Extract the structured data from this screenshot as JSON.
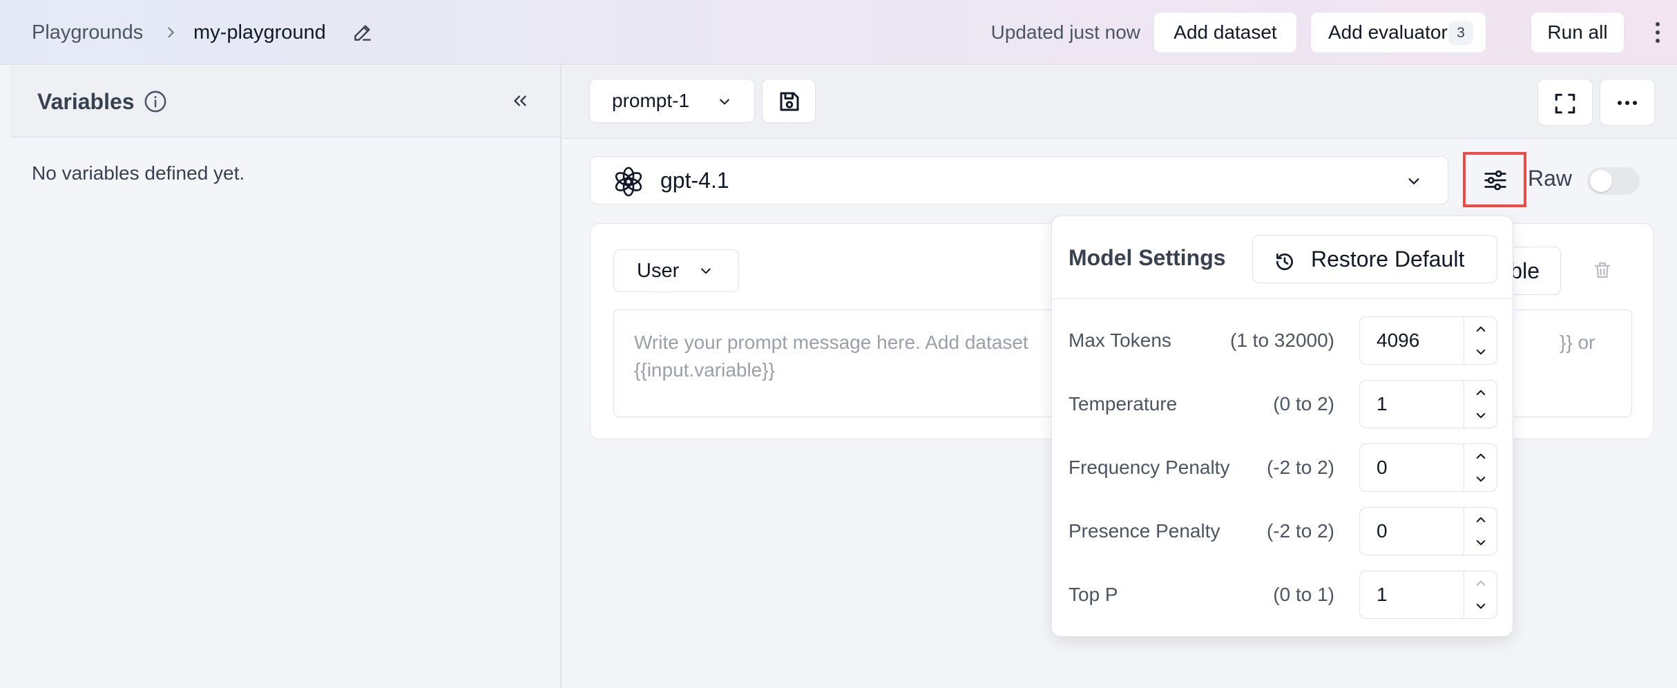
{
  "header": {
    "breadcrumb_root": "Playgrounds",
    "breadcrumb_current": "my-playground",
    "updated_text": "Updated just now",
    "add_dataset_label": "Add dataset",
    "add_evaluator_label": "Add evaluator",
    "evaluator_count": "3",
    "run_all_label": "Run all"
  },
  "variables_panel": {
    "title": "Variables",
    "empty_text": "No variables defined yet."
  },
  "prompt_toolbar": {
    "prompt_name": "prompt-1"
  },
  "model": {
    "name": "gpt-4.1",
    "raw_label": "Raw",
    "raw_enabled": false
  },
  "message": {
    "role": "User",
    "partial_button_text": "ble",
    "placeholder_line1": "Write your prompt message here. Add dataset",
    "placeholder_right_fragment": "}} or",
    "placeholder_line2": "{{input.variable}}"
  },
  "model_settings": {
    "title": "Model Settings",
    "restore_label": "Restore Default",
    "rows": [
      {
        "name": "Max Tokens",
        "range": "(1 to 32000)",
        "value": "4096"
      },
      {
        "name": "Temperature",
        "range": "(0 to 2)",
        "value": "1"
      },
      {
        "name": "Frequency Penalty",
        "range": "(-2 to 2)",
        "value": "0"
      },
      {
        "name": "Presence Penalty",
        "range": "(-2 to 2)",
        "value": "0"
      },
      {
        "name": "Top P",
        "range": "(0 to 1)",
        "value": "1"
      }
    ]
  },
  "colors": {
    "highlight": "#ef4b45",
    "header_gradient_start": "#e5e9f6",
    "header_gradient_end": "#f2e4f0"
  },
  "icons": [
    "chevron-right-icon",
    "pencil-icon",
    "kebab-icon",
    "info-icon",
    "double-chevron-left-icon",
    "chevron-down-icon",
    "save-icon",
    "fullscreen-icon",
    "more-horizontal-icon",
    "openai-icon",
    "sliders-icon",
    "trash-icon",
    "restore-icon",
    "chevron-up-icon"
  ]
}
